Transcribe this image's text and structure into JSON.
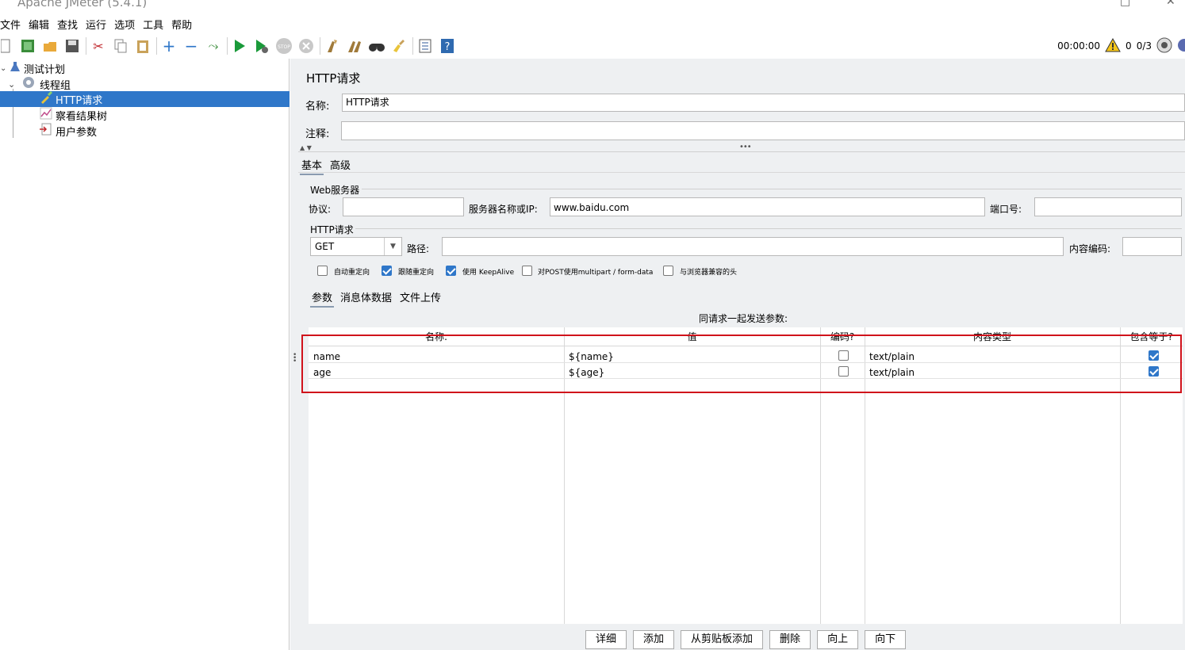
{
  "window": {
    "title": "Apache JMeter (5.4.1)",
    "minimize": "□",
    "close": "✕"
  },
  "menu": [
    "文件",
    "编辑",
    "查找",
    "运行",
    "选项",
    "工具",
    "帮助"
  ],
  "toolbar": {
    "icons": [
      "new-icon",
      "templates-icon",
      "open-icon",
      "save-icon",
      "cut-icon",
      "copy-icon",
      "paste-icon",
      "expand-icon",
      "collapse-icon",
      "toggle-icon",
      "start-icon",
      "start-no-pause-icon",
      "stop-icon",
      "shutdown-icon",
      "clear-icon",
      "clear-all-icon",
      "search-icon",
      "reset-search-icon",
      "function-helper-icon",
      "help-icon"
    ],
    "timer": "00:00:00",
    "warn_count": "0",
    "threads": "0/3"
  },
  "tree": {
    "items": [
      {
        "label": "测试计划",
        "icon": "flask-icon"
      },
      {
        "label": "线程组",
        "icon": "gear-icon"
      },
      {
        "label": "HTTP请求",
        "icon": "pipette-icon"
      },
      {
        "label": "察看结果树",
        "icon": "chart-icon"
      },
      {
        "label": "用户参数",
        "icon": "params-icon"
      }
    ]
  },
  "panel": {
    "title": "HTTP请求",
    "name_label": "名称:",
    "name_value": "HTTP请求",
    "comment_label": "注释:",
    "comment_value": "",
    "tabs": [
      "基本",
      "高级"
    ],
    "web_server": {
      "legend": "Web服务器",
      "protocol_label": "协议:",
      "protocol_value": "",
      "server_label": "服务器名称或IP:",
      "server_value": "www.baidu.com",
      "port_label": "端口号:",
      "port_value": ""
    },
    "http_request": {
      "legend": "HTTP请求",
      "method": "GET",
      "path_label": "路径:",
      "path_value": "",
      "encoding_label": "内容编码:",
      "encoding_value": ""
    },
    "options": [
      {
        "label": "自动重定向",
        "checked": false
      },
      {
        "label": "跟随重定向",
        "checked": true
      },
      {
        "label": "使用 KeepAlive",
        "checked": true
      },
      {
        "label": "对POST使用multipart / form-data",
        "checked": false
      },
      {
        "label": "与浏览器兼容的头",
        "checked": false
      }
    ],
    "sub_tabs": [
      "参数",
      "消息体数据",
      "文件上传"
    ],
    "params_caption": "同请求一起发送参数:",
    "columns": [
      "名称:",
      "值",
      "编码?",
      "内容类型",
      "包含等于?"
    ],
    "rows": [
      {
        "name": "name",
        "value": "${name}",
        "encode": false,
        "content_type": "text/plain",
        "include_equals": true
      },
      {
        "name": "age",
        "value": "${age}",
        "encode": false,
        "content_type": "text/plain",
        "include_equals": true
      }
    ],
    "buttons": [
      "详细",
      "添加",
      "从剪贴板添加",
      "删除",
      "向上",
      "向下"
    ]
  }
}
